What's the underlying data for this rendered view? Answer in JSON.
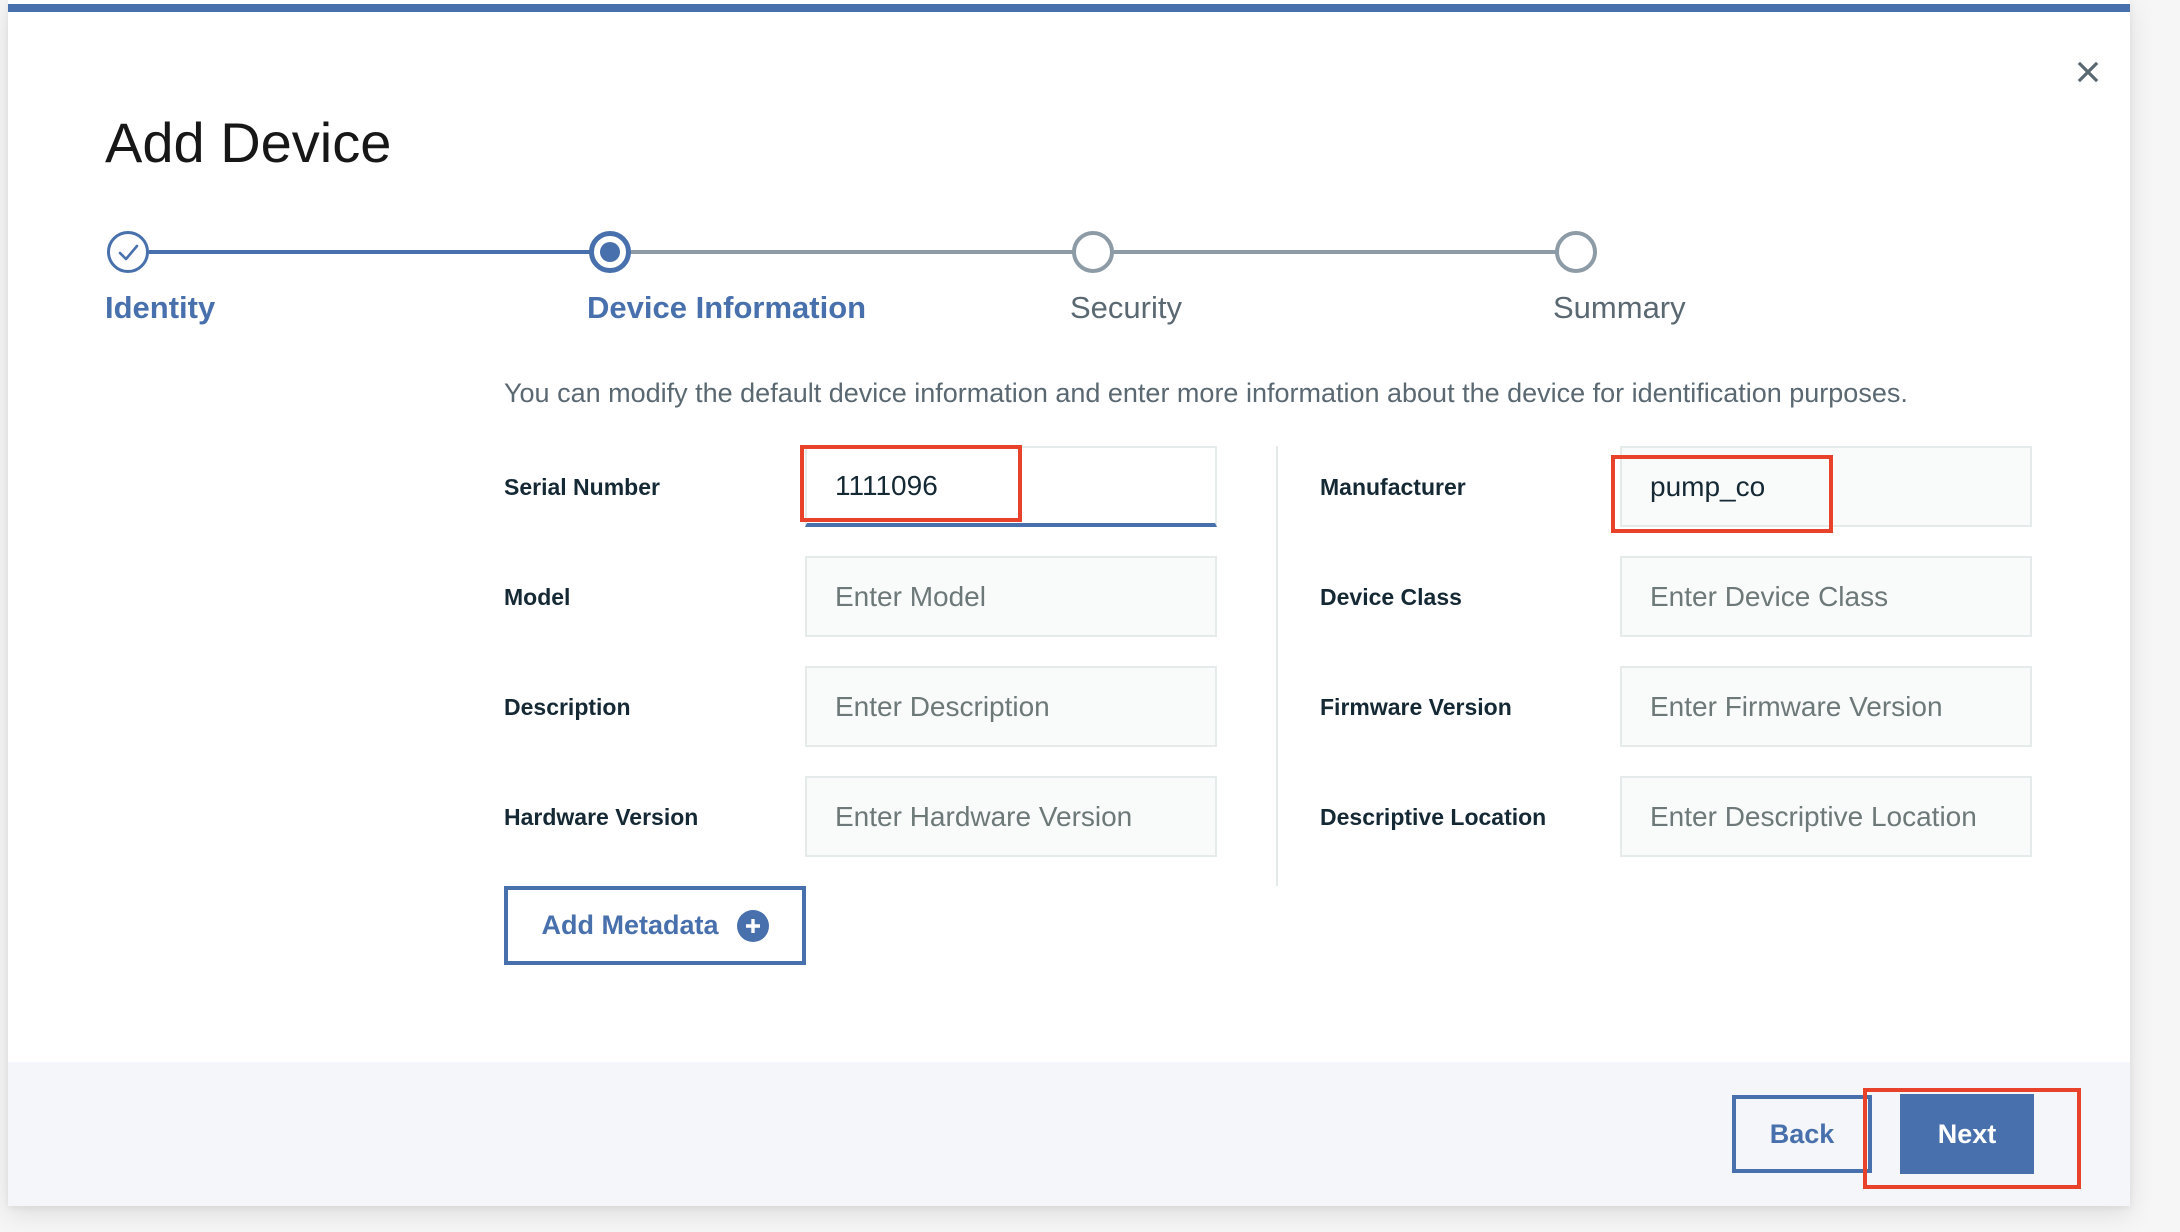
{
  "modal": {
    "title": "Add Device",
    "close_icon": "close-icon",
    "accent_color": "#4870ad"
  },
  "stepper": {
    "steps": [
      {
        "label": "Identity",
        "state": "complete"
      },
      {
        "label": "Device Information",
        "state": "current"
      },
      {
        "label": "Security",
        "state": "incomplete"
      },
      {
        "label": "Summary",
        "state": "incomplete"
      }
    ]
  },
  "form": {
    "description": "You can modify the default device information and enter more information about the device for identification purposes.",
    "left_fields": [
      {
        "label": "Serial Number",
        "value": "1111096",
        "placeholder": "",
        "focused": true
      },
      {
        "label": "Model",
        "value": "",
        "placeholder": "Enter Model"
      },
      {
        "label": "Description",
        "value": "",
        "placeholder": "Enter Description"
      },
      {
        "label": "Hardware Version",
        "value": "",
        "placeholder": "Enter Hardware Version"
      }
    ],
    "right_fields": [
      {
        "label": "Manufacturer",
        "value": "pump_co",
        "placeholder": ""
      },
      {
        "label": "Device Class",
        "value": "",
        "placeholder": "Enter Device Class"
      },
      {
        "label": "Firmware Version",
        "value": "",
        "placeholder": "Enter Firmware Version"
      },
      {
        "label": "Descriptive Location",
        "value": "",
        "placeholder": "Enter Descriptive Location"
      }
    ],
    "add_metadata_label": "Add Metadata"
  },
  "footer": {
    "back_label": "Back",
    "next_label": "Next"
  },
  "annotations": {
    "highlight_color": "#e8432a"
  }
}
